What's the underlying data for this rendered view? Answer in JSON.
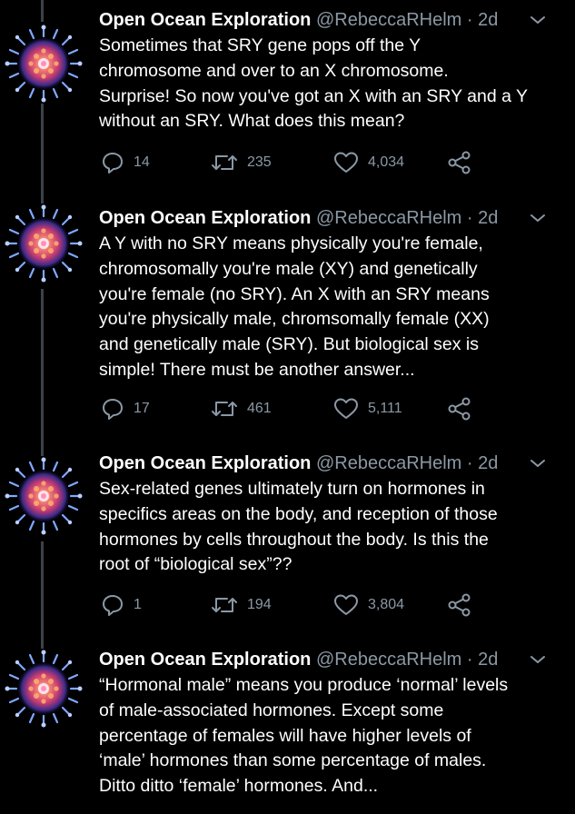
{
  "tweets": [
    {
      "name": "Open Ocean Exploration",
      "handle": "@RebeccaRHelm",
      "separator": "·",
      "time": "2d",
      "lines": [
        "Sometimes that SRY gene pops off the Y",
        "chromosome and over to an X chromosome.",
        "Surprise! So now you've got an X with an SRY and a Y",
        "without an SRY. What does this mean?"
      ],
      "replies": "14",
      "retweets": "235",
      "likes": "4,034"
    },
    {
      "name": "Open Ocean Exploration",
      "handle": "@RebeccaRHelm",
      "separator": "·",
      "time": "2d",
      "lines": [
        "A Y with no SRY means physically you're female,",
        "chromosomally you're male (XY) and genetically",
        "you're female (no SRY). An X with an SRY means",
        "you're physically male, chromsomally female (XX)",
        "and genetically male (SRY). But biological sex is",
        "simple! There must be another answer..."
      ],
      "replies": "17",
      "retweets": "461",
      "likes": "5,111"
    },
    {
      "name": "Open Ocean Exploration",
      "handle": "@RebeccaRHelm",
      "separator": "·",
      "time": "2d",
      "lines": [
        "Sex-related genes ultimately turn on hormones in",
        "specifics areas on the body, and reception of those",
        "hormones by cells throughout the body. Is this the",
        "root of “biological sex”??"
      ],
      "replies": "1",
      "retweets": "194",
      "likes": "3,804"
    },
    {
      "name": "Open Ocean Exploration",
      "handle": "@RebeccaRHelm",
      "separator": "·",
      "time": "2d",
      "lines": [
        "“Hormonal male” means you produce ‘normal’ levels",
        "of male-associated  hormones. Except some",
        "percentage of females will have higher levels of",
        "‘male’ hormones than some percentage of males.",
        "Ditto ditto ‘female’ hormones. And..."
      ]
    }
  ],
  "colors": {
    "background": "#000000",
    "text": "#ffffff",
    "secondary": "#8b98a5",
    "thread_line": "#3d4248"
  },
  "icons": {
    "reply": "reply-icon",
    "retweet": "retweet-icon",
    "like": "heart-icon",
    "share": "share-icon",
    "menu": "chevron-down-icon"
  }
}
